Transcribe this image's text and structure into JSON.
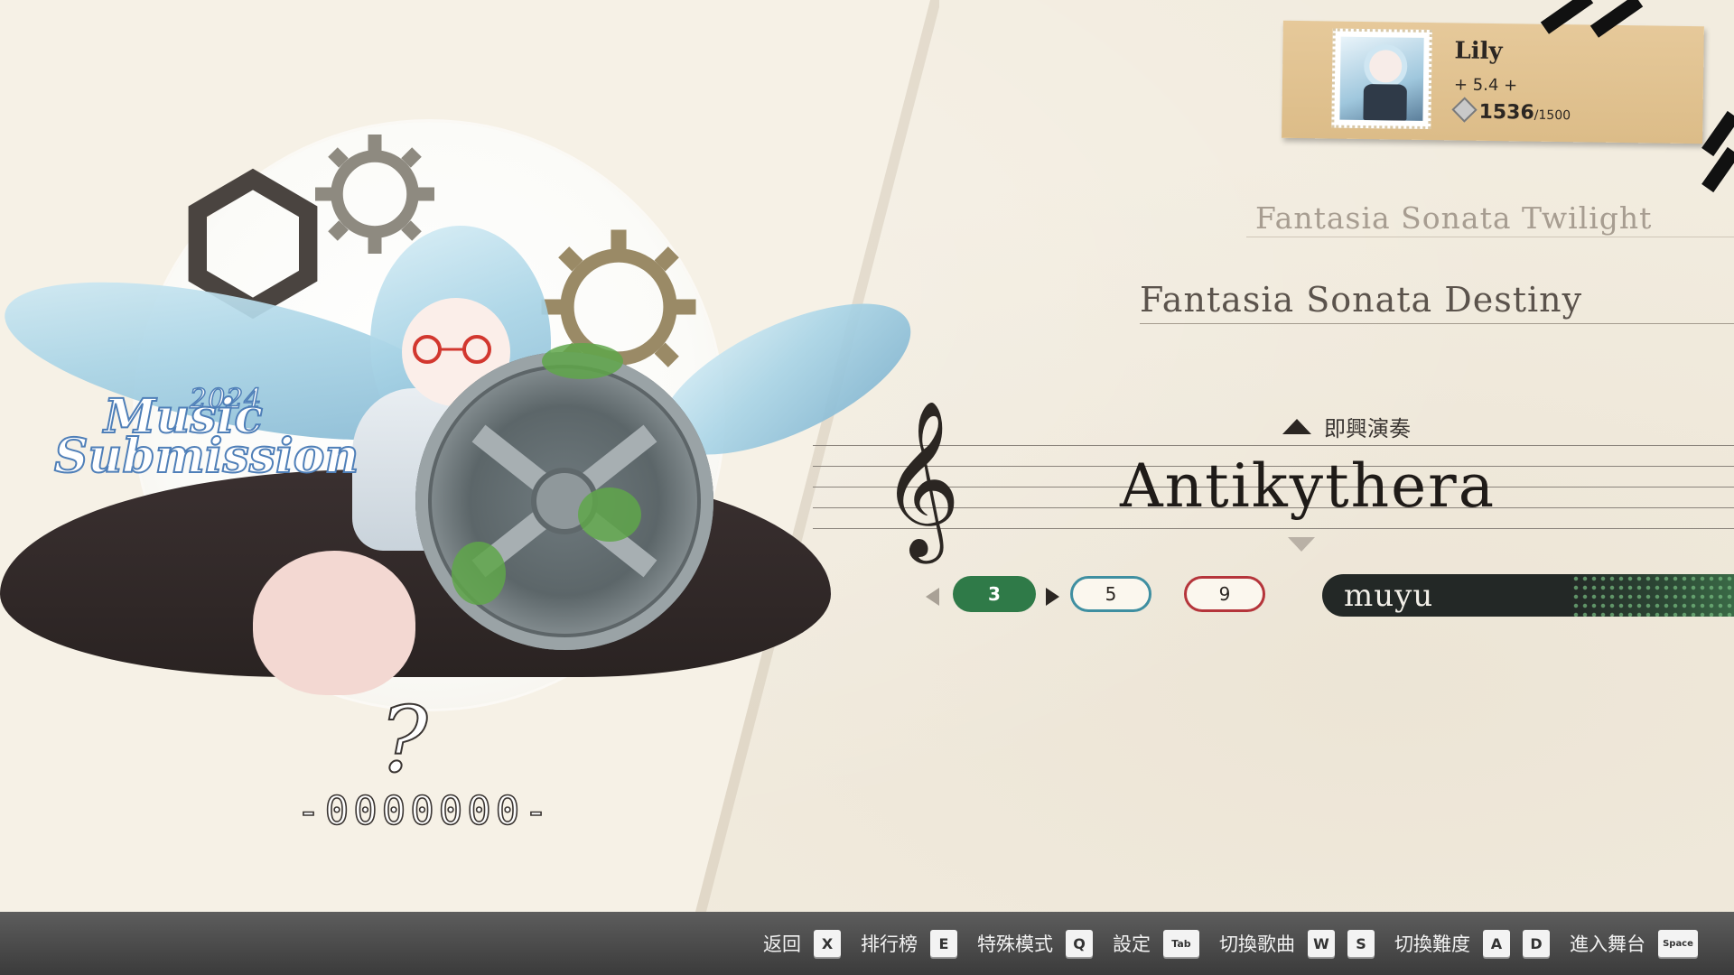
{
  "player": {
    "name": "Lily",
    "rating": "+ 5.4 +",
    "coins": "1536",
    "coins_max": "/1500"
  },
  "event_logo": {
    "year": "2024",
    "line1": "Music",
    "line2": "Submission"
  },
  "record": {
    "rank": "?",
    "score": "-0000000-"
  },
  "song_list": {
    "prev2": "Fantasia Sonata Twilight",
    "prev1": "Fantasia Sonata Destiny",
    "current": "Antikythera"
  },
  "mode_label": "即興演奏",
  "difficulties": [
    {
      "level": "3",
      "color": "#2f7a48",
      "selected": true
    },
    {
      "level": "5",
      "color": "#3f8fa1",
      "selected": false
    },
    {
      "level": "9",
      "color": "#b5353b",
      "selected": false
    }
  ],
  "artist": "muyu",
  "hints": [
    {
      "label": "返回",
      "keys": [
        "X"
      ]
    },
    {
      "label": "排行榜",
      "keys": [
        "E"
      ]
    },
    {
      "label": "特殊模式",
      "keys": [
        "Q"
      ]
    },
    {
      "label": "設定",
      "keys": [
        "Tab"
      ]
    },
    {
      "label": "切換歌曲",
      "keys": [
        "W",
        "S"
      ]
    },
    {
      "label": "切換難度",
      "keys": [
        "A",
        "D"
      ]
    },
    {
      "label": "進入舞台",
      "keys": [
        "Space"
      ]
    }
  ]
}
